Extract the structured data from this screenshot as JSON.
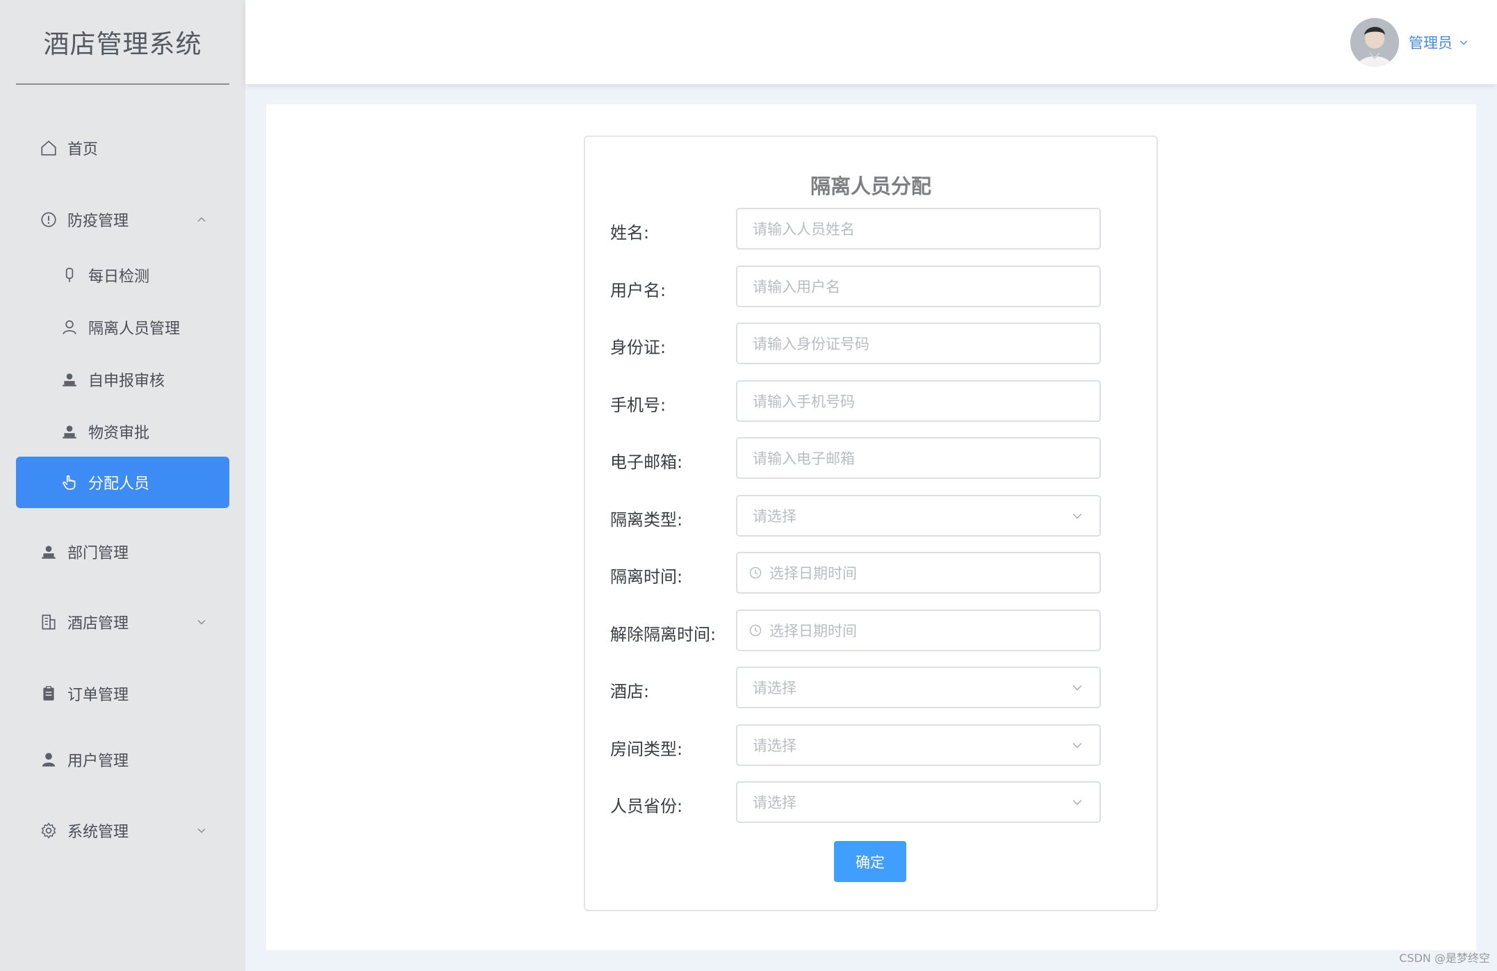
{
  "app": {
    "title": "酒店管理系统"
  },
  "sidebar": {
    "items": [
      {
        "label": "首页"
      },
      {
        "label": "防疫管理"
      },
      {
        "label": "每日检测"
      },
      {
        "label": "隔离人员管理"
      },
      {
        "label": "自申报审核"
      },
      {
        "label": "物资审批"
      },
      {
        "label": "分配人员"
      },
      {
        "label": "部门管理"
      },
      {
        "label": "酒店管理"
      },
      {
        "label": "订单管理"
      },
      {
        "label": "用户管理"
      },
      {
        "label": "系统管理"
      }
    ],
    "active_color": "#3d8cf5"
  },
  "header": {
    "user": "管理员"
  },
  "form": {
    "title": "隔离人员分配",
    "fields": [
      {
        "label": "姓名:",
        "placeholder": "请输入人员姓名"
      },
      {
        "label": "用户名:",
        "placeholder": "请输入用户名"
      },
      {
        "label": "身份证:",
        "placeholder": "请输入身份证号码"
      },
      {
        "label": "手机号:",
        "placeholder": "请输入手机号码"
      },
      {
        "label": "电子邮箱:",
        "placeholder": "请输入电子邮箱"
      },
      {
        "label": "隔离类型:",
        "placeholder": "请选择"
      },
      {
        "label": "隔离时间:",
        "placeholder": "选择日期时间"
      },
      {
        "label": "解除隔离时间:",
        "placeholder": "选择日期时间"
      },
      {
        "label": "酒店:",
        "placeholder": "请选择"
      },
      {
        "label": "房间类型:",
        "placeholder": "请选择"
      },
      {
        "label": "人员省份:",
        "placeholder": "请选择"
      }
    ],
    "submit_label": "确定",
    "accent_color": "#409eff"
  },
  "watermark": "CSDN @是梦终空"
}
